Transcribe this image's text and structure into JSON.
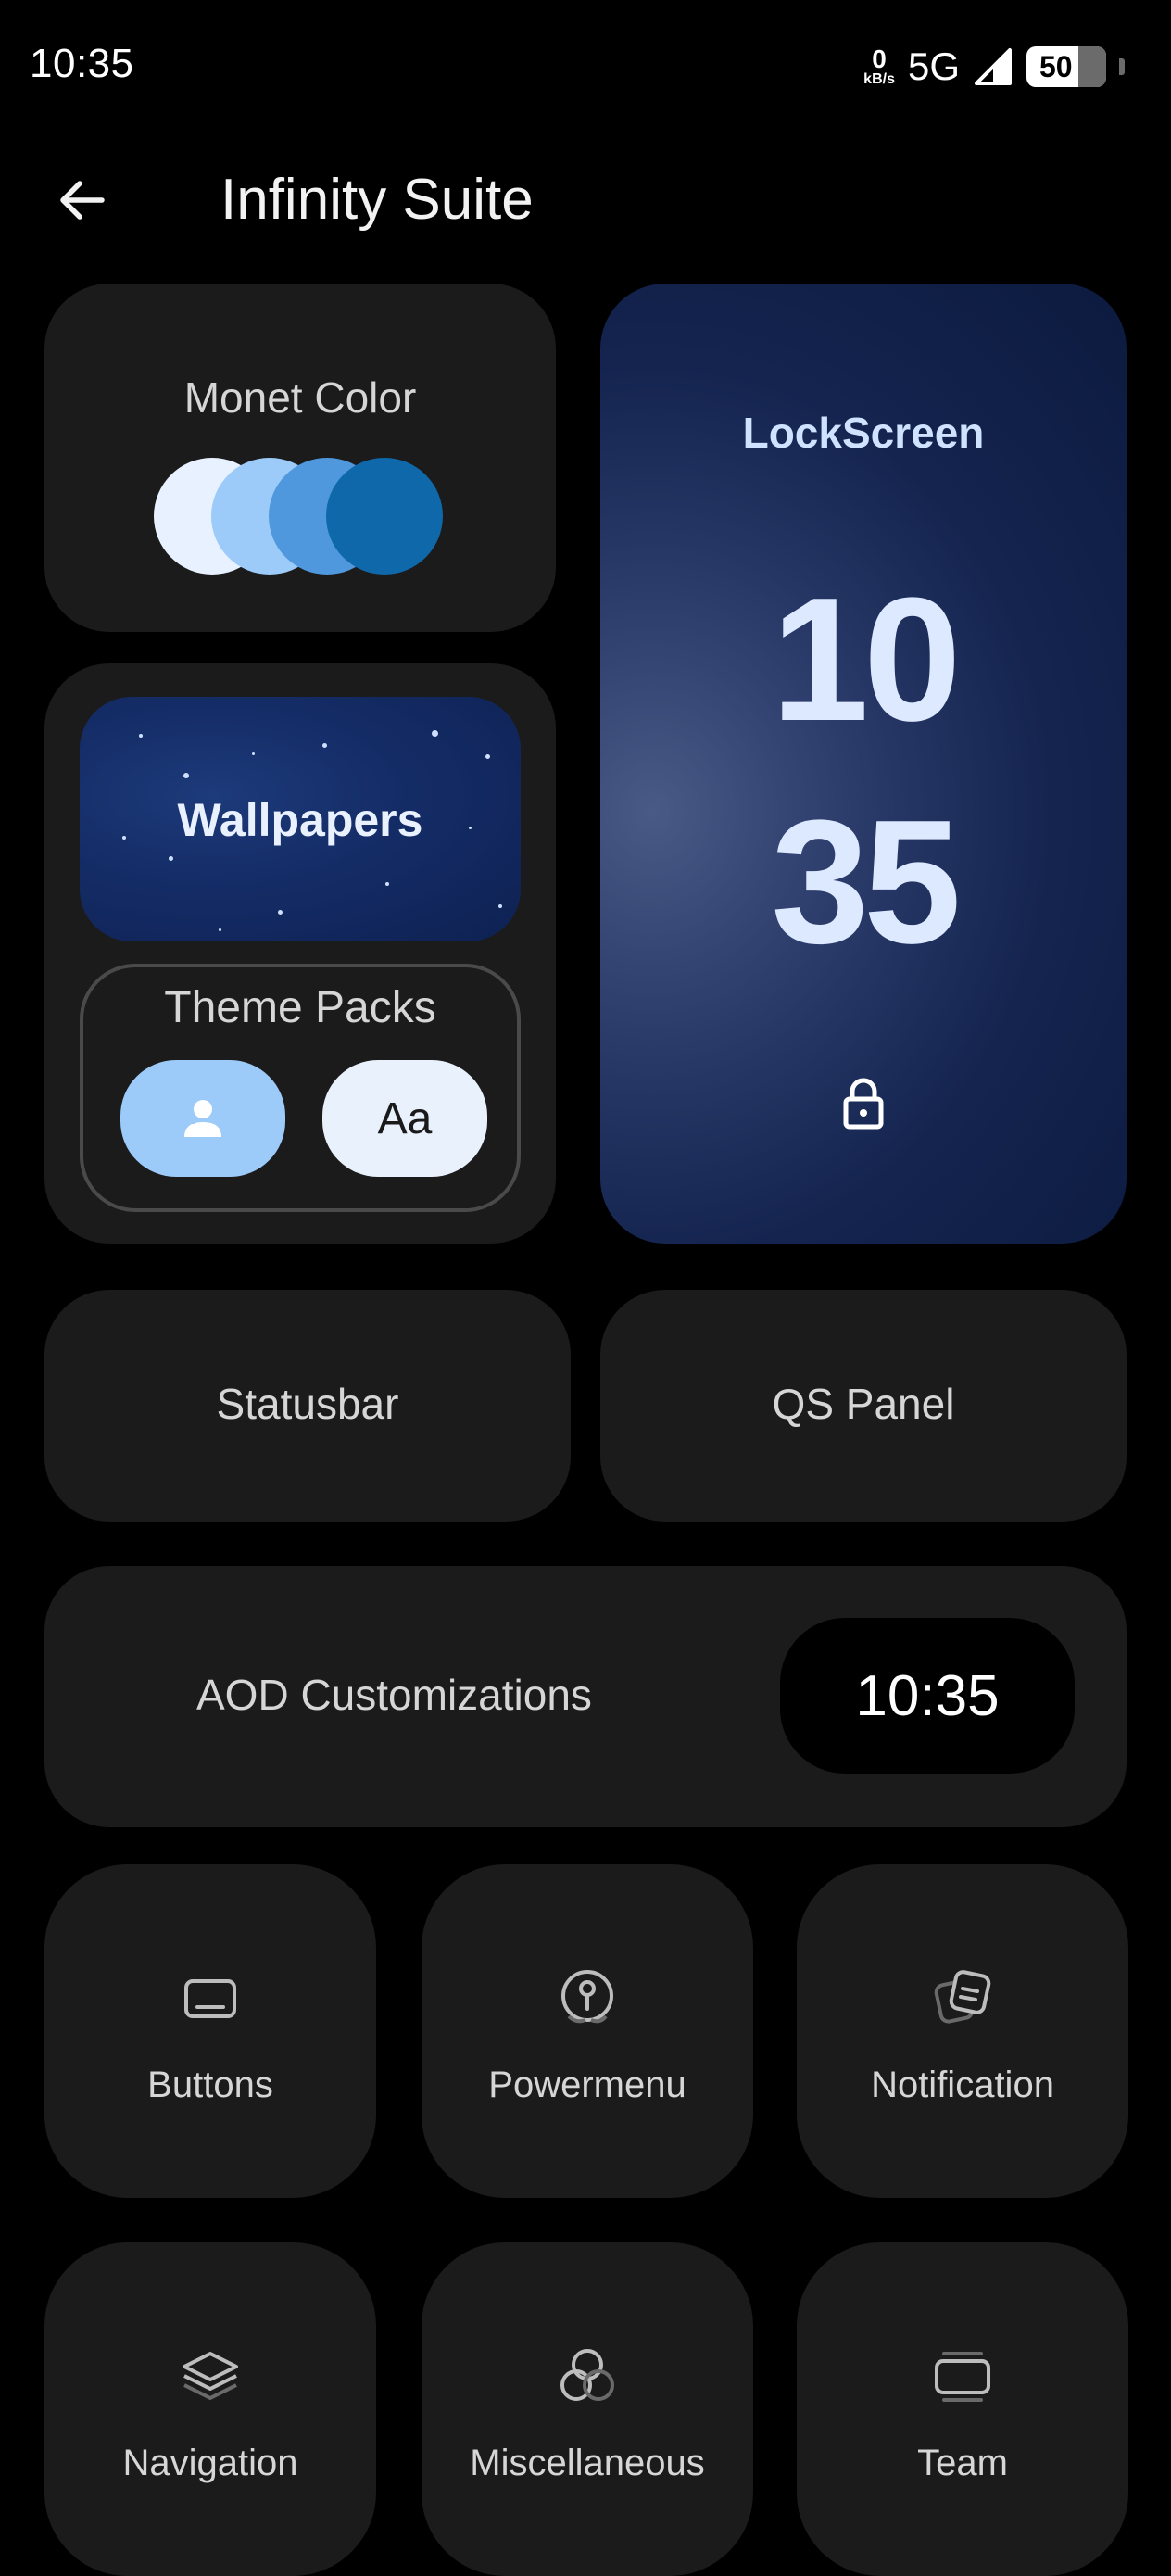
{
  "status_bar": {
    "time": "10:35",
    "net_speed_value": "0",
    "net_speed_unit": "kB/s",
    "network": "5G",
    "battery_level": "50"
  },
  "header": {
    "title": "Infinity Suite"
  },
  "monet": {
    "title": "Monet Color",
    "swatches": [
      "#e8f1ff",
      "#9ccaf9",
      "#4f98de",
      "#0f68aa"
    ]
  },
  "wallpapers": {
    "label": "Wallpapers"
  },
  "theme_packs": {
    "title": "Theme Packs",
    "fonts_label": "Aa"
  },
  "lockscreen": {
    "title": "LockScreen",
    "hour": "10",
    "minute": "35"
  },
  "statusbar": {
    "label": "Statusbar"
  },
  "qs_panel": {
    "label": "QS Panel"
  },
  "aod": {
    "label": "AOD Customizations",
    "clock": "10:35"
  },
  "tiles": [
    {
      "label": "Buttons",
      "icon": "buttons-icon"
    },
    {
      "label": "Powermenu",
      "icon": "power-icon"
    },
    {
      "label": "Notification",
      "icon": "notification-icon"
    },
    {
      "label": "Navigation",
      "icon": "layers-icon"
    },
    {
      "label": "Miscellaneous",
      "icon": "circles-icon"
    },
    {
      "label": "Team",
      "icon": "team-icon"
    }
  ],
  "colors": {
    "background": "#000000",
    "card": "#1b1b1b",
    "accent": "#9ccaf9"
  }
}
